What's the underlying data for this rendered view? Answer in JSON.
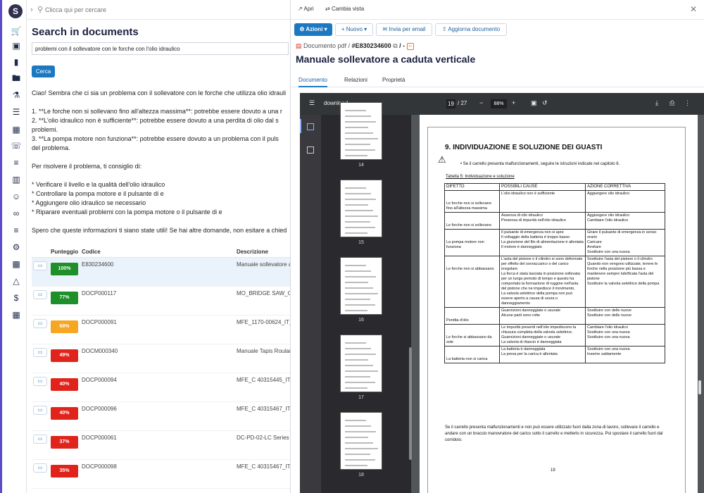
{
  "topbar": {
    "search_placeholder": "Clicca qui per cercare"
  },
  "search": {
    "title": "Search in documents",
    "query": "problemi con il sollevatore con le forche con l'olio idraulico",
    "button": "Cerca"
  },
  "answer": {
    "lines": [
      "Ciao! Sembra che ci sia un problema con il sollevatore con le forche che utilizza olio idrauli",
      "",
      "1. **Le forche non si sollevano fino all'altezza massima**: potrebbe essere dovuto a una r",
      "2. **L'olio idraulico non è sufficiente**: potrebbe essere dovuto a una perdita di olio dal s",
      "problemi.",
      "3. **La pompa motore non funziona**: potrebbe essere dovuto a un problema con il puls",
      "del problema.",
      "",
      "Per risolvere il problema, ti consiglio di:",
      "",
      "* Verificare il livello e la qualità dell'olio idraulico",
      "* Controllare la pompa motore e il pulsante di e",
      "* Aggiungere olio idraulico se necessario",
      "* Riparare eventuali problemi con la pompa motore o il pulsante di e",
      "",
      "Spero che queste informazioni ti siano state utili! Se hai altre domande, non esitare a chied"
    ]
  },
  "results": {
    "headers": {
      "score": "Punteggio",
      "code": "Codice",
      "desc": "Descrizione"
    },
    "rows": [
      {
        "score": "100%",
        "color": "#1f8f2a",
        "code": "E830234600",
        "desc": "Manuale sollevatore a"
      },
      {
        "score": "77%",
        "color": "#1f8f2a",
        "code": "DOCP000117",
        "desc": "MO_BRIDGE SAW_GE"
      },
      {
        "score": "68%",
        "color": "#f5a623",
        "code": "DOCP000091",
        "desc": "MFE_1170-00624_IT_"
      },
      {
        "score": "49%",
        "color": "#e0241c",
        "code": "DOCM000340",
        "desc": "Manuale Tapis Roulan"
      },
      {
        "score": "40%",
        "color": "#e0241c",
        "code": "DOCP000094",
        "desc": "MFE_C 40315445_IT_S"
      },
      {
        "score": "40%",
        "color": "#e0241c",
        "code": "DOCP000096",
        "desc": "MFE_C 40315467_IT_S"
      },
      {
        "score": "37%",
        "color": "#e0241c",
        "code": "DOCP000061",
        "desc": "DC-PD-02-LC Series IT"
      },
      {
        "score": "35%",
        "color": "#e0241c",
        "code": "DOCP000098",
        "desc": "MFE_C 40315467_IT_S"
      }
    ]
  },
  "panel": {
    "open": "Apri",
    "change_view": "Cambia vista",
    "actions": {
      "azioni": "Azioni",
      "nuovo": "Nuovo",
      "email": "Invia per email",
      "update": "Aggiorna documento"
    },
    "crumb": {
      "type": "Documento pdf",
      "sep": "/",
      "code": "#E830234600",
      "tail": "/ -"
    },
    "title": "Manuale sollevatore a caduta verticale",
    "tabs": [
      "Documento",
      "Relazioni",
      "Proprietà"
    ]
  },
  "viewer": {
    "filename": "download",
    "page_current": "19",
    "page_total": "/ 27",
    "zoom": "88%",
    "thumb_labels": [
      "14",
      "15",
      "16",
      "17",
      "18"
    ]
  },
  "pdf_page": {
    "heading": "9.  INDIVIDUAZIONE E SOLUZIONE DEI GUASTI",
    "note": "Se il carrello presenta malfunzionamenti, seguire le istruzioni indicate nel capitolo 6.",
    "caption": "Tabella 5: Individuazione e soluzione",
    "columns": [
      "DIFETTO",
      "POSSIBILI CAUSE",
      "AZIONE CORRETTIVA"
    ],
    "rows": [
      {
        "defect": "Le forche non si sollevano fino all'altezza massima",
        "cause": "L'olio idraulico non è sufficiente",
        "action": "Aggiungere olio idraulico"
      },
      {
        "defect": "Le forche non si sollevano",
        "cause": "Assenza di olio idraulico\nPresenza di impurità nell'olio idraulico",
        "action": "Aggiungere olio idraulico\nCambiare l'olio idraulico"
      },
      {
        "defect": "La pompa motore non funziona",
        "cause": "Il pulsante di emergenza non si apre\nIl voltaggio della batteria è troppo basso\nLa giunzione del filo di alimentazione è allentata\nIl motore è danneggiato",
        "action": "Girare il pulsante di emergenza in senso orario\nCaricare\nAvvitare\nSostituire con una nuova"
      },
      {
        "defect": "Le forche non si abbassano",
        "cause": "L'asta del pistone o il cilindro si sono deformate per effetto del sovraccarico o del carico irregolare\nLa forca è stata lasciata in posizione sollevata per un lungo periodo di tempo e questo ha comportato la formazione di ruggine nell'asta del pistone che ne impedisce il movimento.\nLa valvola selettrice della pompa non può essere aperto a causa di usura o danneggiamento",
        "action": "Sostituire l'asta del pistone o il cilindro\nQuando non vengono utilizzate, tenere le forche nella posizione più bassa e mantenere sempre lubrificata l'asta del pistone\nSostituire la valvola selettrice della pompa"
      },
      {
        "defect": "Perdita d'olio",
        "cause": "Guarnizioni danneggiate o usurate\nAlcune parti sono rotte",
        "action": "Sostituire con delle nuove\nSostituire con delle nuove"
      },
      {
        "defect": "Le forche si abbassano da sole",
        "cause": "Le impurità presenti nell'olio impediscono la chiusura completa della valvola selettrice.\nGuarnizioni danneggiate o usurate\nLa valvola di rilascio è danneggiata",
        "action": "Cambiare l'olio idraulico\nSostituire con una nuova\nSostituire con una nuova"
      },
      {
        "defect": "La batteria non si carica",
        "cause": "La batteria è danneggiata\nLa presa per la carica è allentata",
        "action": "Sostituire con una nuova\nInserire saldamente"
      }
    ],
    "footer": "Se il carrello presenta malfunzionamenti e non può essere utilizzato fuori dalla zona di lavoro, sollevare il carrello e andare con un braccio manovratore del carico sotto il carrello e metterlo in sicurezza. Poi spostare il carrello fuori dal corridoio.",
    "page_number": "19"
  },
  "icons": [
    "logo-icon",
    "cart-icon",
    "box-icon",
    "bookmark-icon",
    "folder-icon",
    "flask-icon",
    "building-icon",
    "headset-icon",
    "list-icon",
    "calendar-icon",
    "users-icon",
    "link-icon",
    "ticket-icon",
    "tractor-icon",
    "factory-icon",
    "bottle-icon",
    "dollar-icon",
    "grid-icon"
  ]
}
